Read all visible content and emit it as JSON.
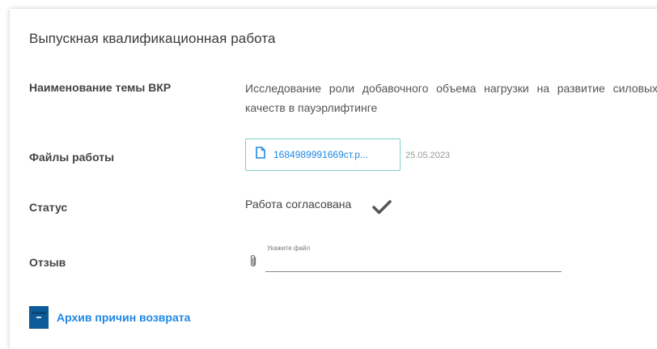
{
  "section": {
    "title": "Выпускная квалификационная работа"
  },
  "topic": {
    "label": "Наименование темы ВКР",
    "value": "Исследование роли добавочного объема нагрузки на развитие силовых качеств в пауэрлифтинге"
  },
  "files": {
    "label": "Файлы работы",
    "file_name": "1684989991669ст.р...",
    "date": "25.05.2023",
    "icon": "file-icon"
  },
  "status": {
    "label": "Статус",
    "value": "Работа согласована",
    "icon": "checkmark-icon"
  },
  "review": {
    "label": "Отзыв",
    "hint": "Укажите файл",
    "icon": "paperclip-icon"
  },
  "archive": {
    "label": "Архив причин возврата",
    "icon": "archive-box-icon"
  },
  "colors": {
    "accent": "#1e88e5",
    "chip_border": "#7fd0c8",
    "archive_icon": "#0d5c99"
  }
}
